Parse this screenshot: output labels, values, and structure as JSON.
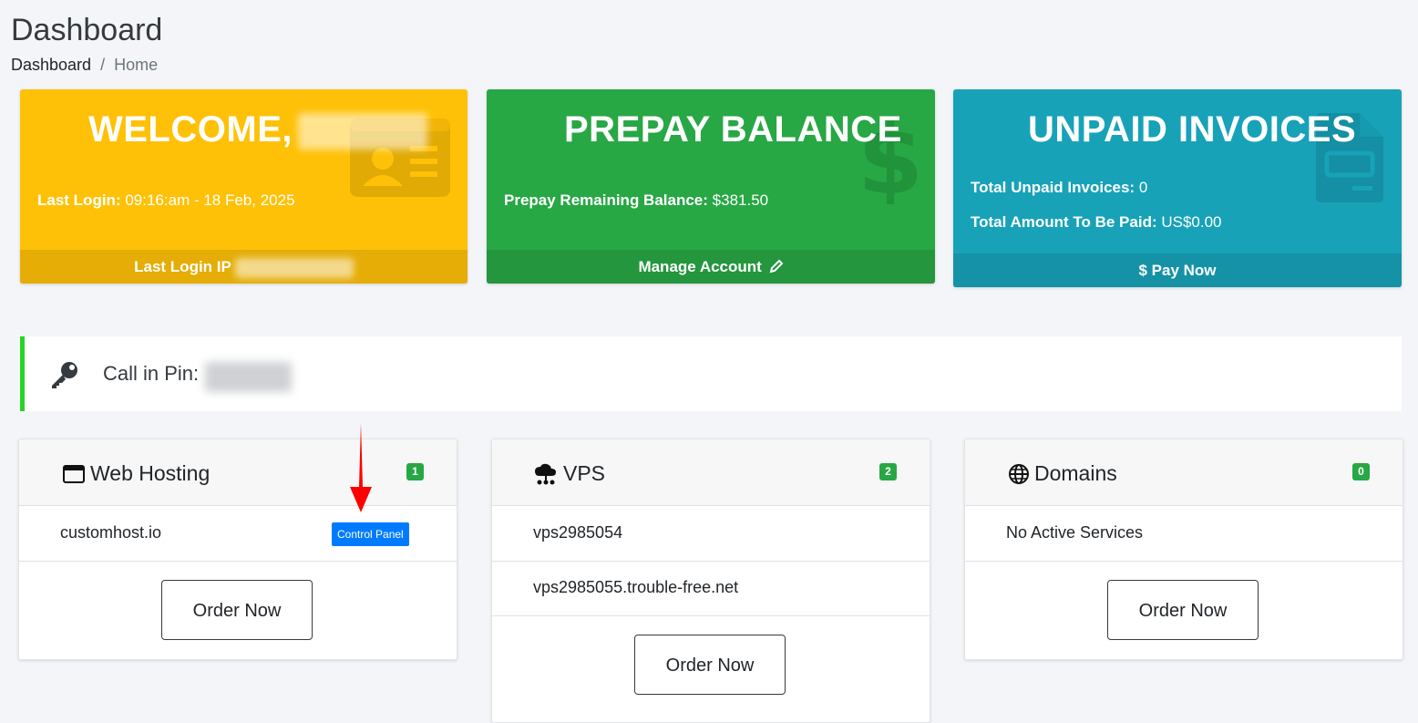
{
  "header": {
    "title": "Dashboard",
    "breadcrumb": [
      "Dashboard",
      "Home"
    ],
    "breadcrumb_sep": "/"
  },
  "cards": {
    "welcome": {
      "title": "WELCOME,",
      "last_login_label": "Last Login:",
      "last_login_value": "09:16:am - 18 Feb, 2025",
      "footer": "Last Login IP",
      "color": "#ffc107"
    },
    "prepay": {
      "title": "PREPAY BALANCE",
      "remaining_label": "Prepay Remaining Balance:",
      "remaining_value": "$381.50",
      "footer": "Manage Account",
      "color": "#28a745"
    },
    "unpaid": {
      "title": "UNPAID INVOICES",
      "total_label": "Total Unpaid Invoices:",
      "total_value": "0",
      "amount_label": "Total Amount To Be Paid:",
      "amount_value": "US$0.00",
      "footer": "Pay Now",
      "color": "#17a2b8"
    }
  },
  "pin": {
    "label": "Call in Pin:",
    "icon": "key-icon"
  },
  "services": {
    "hosting": {
      "title": "Web Hosting",
      "count": "1",
      "items": [
        {
          "name": "customhost.io",
          "action": "Control Panel"
        }
      ],
      "order": "Order Now"
    },
    "vps": {
      "title": "VPS",
      "count": "2",
      "items": [
        {
          "name": "vps2985054"
        },
        {
          "name": "vps2985055.trouble-free.net"
        }
      ],
      "order": "Order Now"
    },
    "domains": {
      "title": "Domains",
      "count": "0",
      "items": [
        {
          "name": "No Active Services"
        }
      ],
      "order": "Order Now"
    }
  }
}
